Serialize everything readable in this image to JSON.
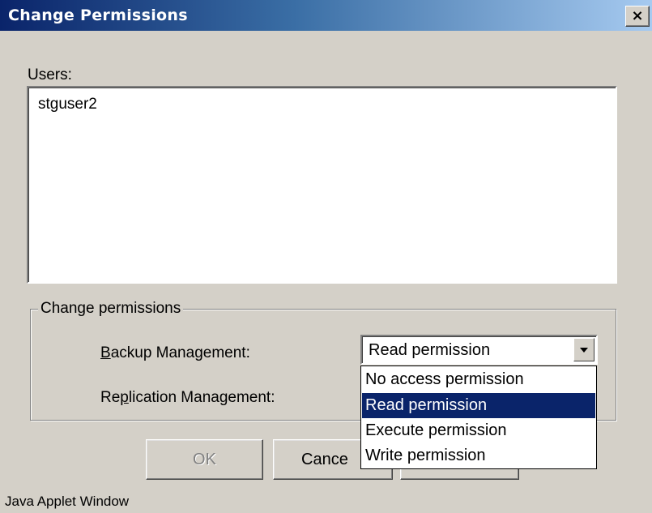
{
  "window": {
    "title": "Change Permissions",
    "close_label": "×"
  },
  "users": {
    "label": "Users:",
    "items": [
      "stguser2"
    ]
  },
  "permissions_group": {
    "legend": "Change permissions",
    "backup": {
      "label_prefix": "",
      "label_mnemonic": "B",
      "label_rest": "ackup Management:",
      "selected_value": "Read permission"
    },
    "replication": {
      "label_prefix": "Re",
      "label_mnemonic": "p",
      "label_rest": "lication Management:"
    }
  },
  "dropdown": {
    "options": [
      "No access permission",
      "Read permission",
      "Execute permission",
      "Write permission"
    ],
    "selected_index": 1
  },
  "buttons": {
    "ok_label": "OK",
    "cancel_label": "Cance"
  },
  "status_bar": {
    "text": "Java Applet Window"
  }
}
